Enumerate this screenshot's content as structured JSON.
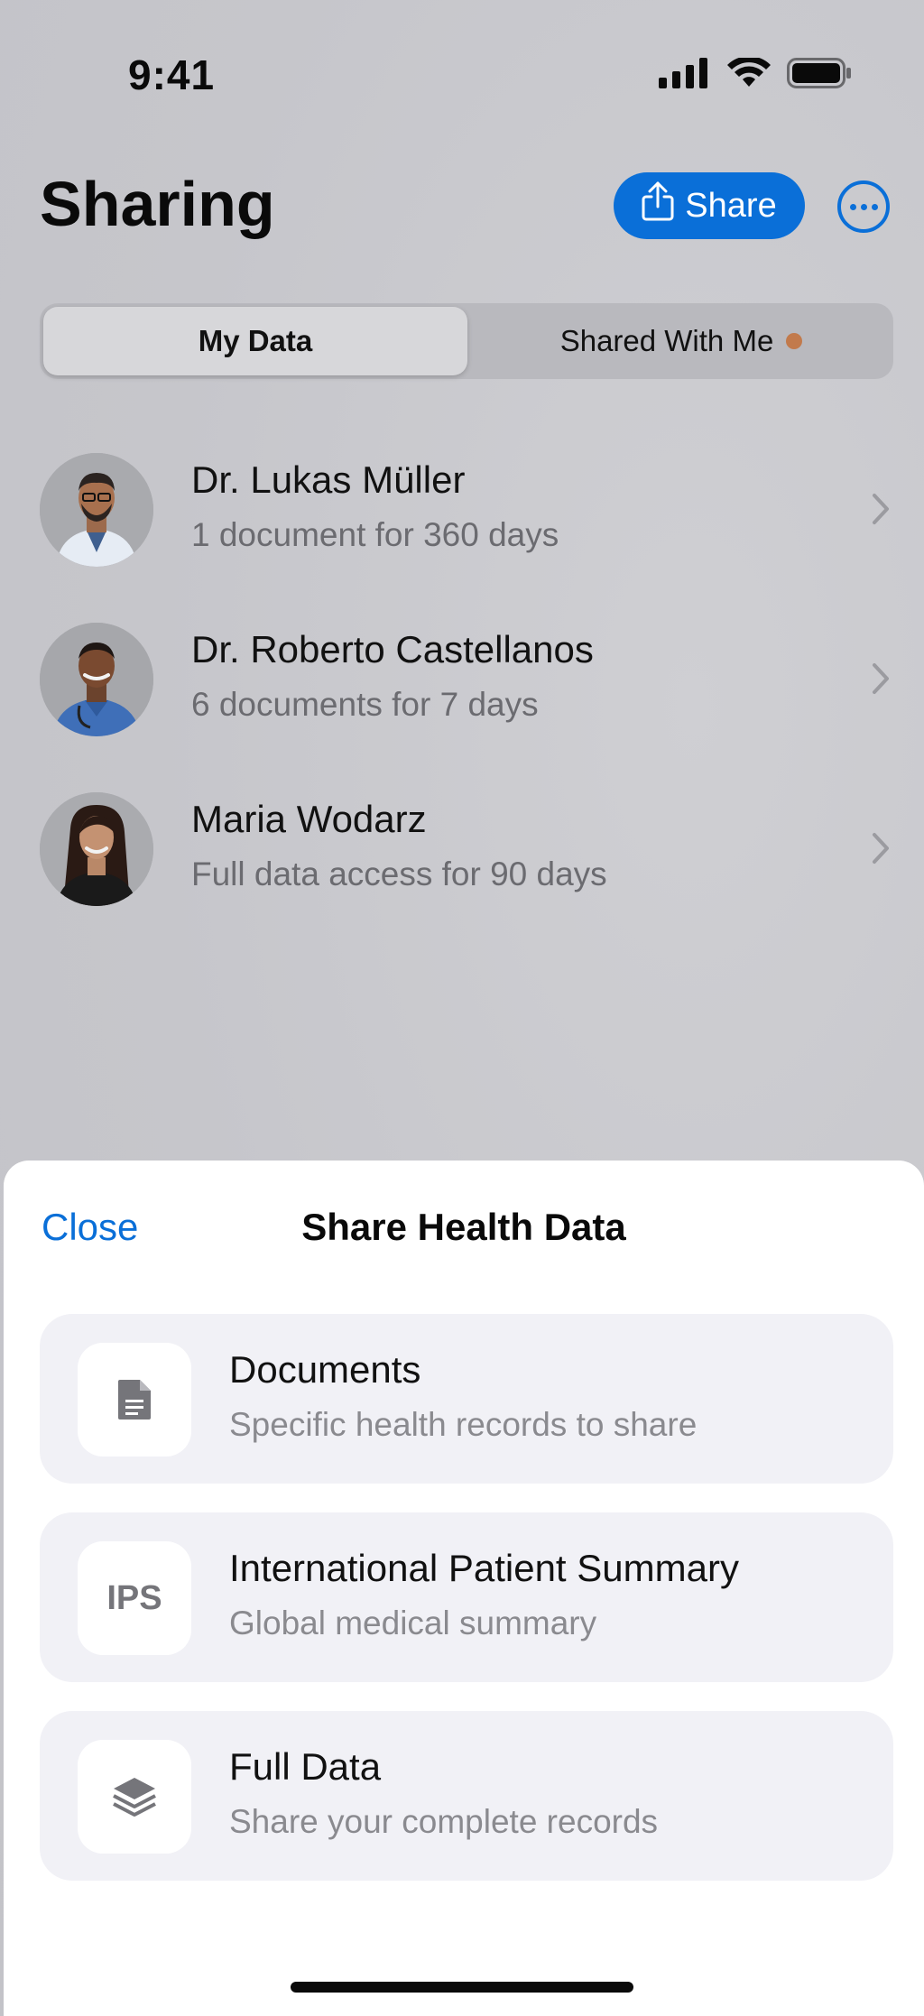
{
  "status_bar": {
    "time": "9:41"
  },
  "header": {
    "title": "Sharing",
    "share_label": "Share"
  },
  "segments": {
    "my_data": "My Data",
    "shared_with_me": "Shared With Me"
  },
  "contacts": [
    {
      "name": "Dr. Lukas Müller",
      "detail": "1 document for 360 days"
    },
    {
      "name": "Dr. Roberto Castellanos",
      "detail": "6 documents for 7 days"
    },
    {
      "name": "Maria Wodarz",
      "detail": "Full data access for 90 days"
    }
  ],
  "sheet": {
    "close_label": "Close",
    "title": "Share Health Data",
    "options": [
      {
        "icon": "document-icon",
        "title": "Documents",
        "subtitle": "Specific health records to share"
      },
      {
        "icon_text": "IPS",
        "title": "International Patient Summary",
        "subtitle": "Global medical summary"
      },
      {
        "icon": "layers-icon",
        "title": "Full Data",
        "subtitle": "Share your complete records"
      }
    ]
  },
  "colors": {
    "accent": "#0a6fd8",
    "badge": "#c27a4c"
  }
}
